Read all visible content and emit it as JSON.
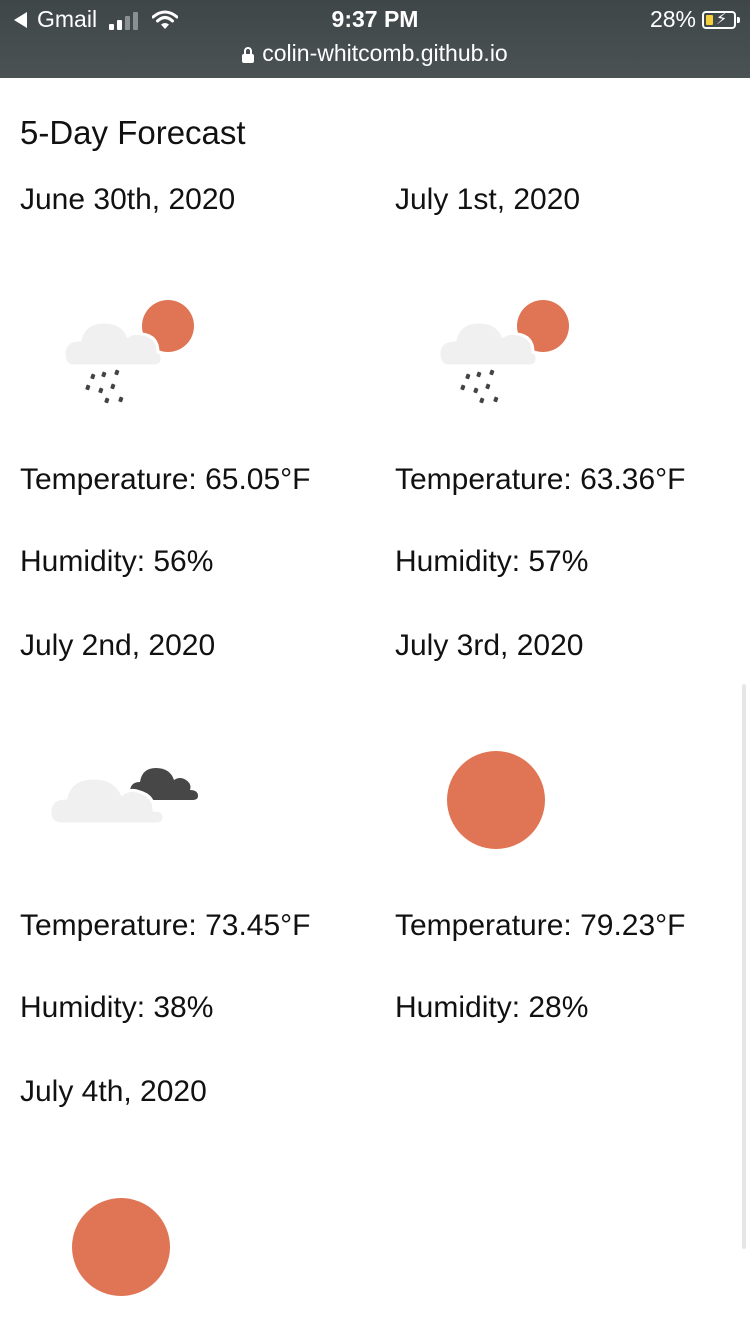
{
  "status_bar": {
    "back_app": "Gmail",
    "time": "9:37 PM",
    "battery_percent": "28%",
    "battery_level": 0.28,
    "url": "colin-whitcomb.github.io"
  },
  "page": {
    "title": "5-Day Forecast"
  },
  "forecast": [
    {
      "date": "June 30th, 2020",
      "icon": "cloud-sun-rain-icon",
      "temperature": "Temperature: 65.05°F",
      "humidity": "Humidity: 56%"
    },
    {
      "date": "July 1st, 2020",
      "icon": "cloud-sun-rain-icon",
      "temperature": "Temperature: 63.36°F",
      "humidity": "Humidity: 57%"
    },
    {
      "date": "July 2nd, 2020",
      "icon": "cloudy-icon",
      "temperature": "Temperature: 73.45°F",
      "humidity": "Humidity: 38%"
    },
    {
      "date": "July 3rd, 2020",
      "icon": "sun-icon",
      "temperature": "Temperature: 79.23°F",
      "humidity": "Humidity: 28%"
    },
    {
      "date": "July 4th, 2020",
      "icon": "sun-icon"
    }
  ],
  "colors": {
    "sun": "#df7555",
    "cloud_light": "#f0f0f0",
    "cloud_dark": "#474747",
    "rain": "#444444",
    "status_bar": "#444b4d"
  }
}
